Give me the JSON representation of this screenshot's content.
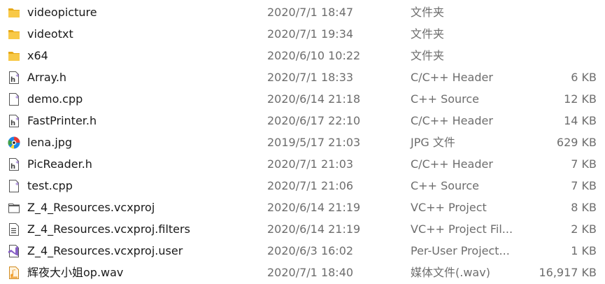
{
  "files": [
    {
      "icon": "folder-icon",
      "name": "videopicture",
      "date": "2020/7/1 18:47",
      "type": "文件夹",
      "size": ""
    },
    {
      "icon": "folder-icon",
      "name": "videotxt",
      "date": "2020/7/1 19:34",
      "type": "文件夹",
      "size": ""
    },
    {
      "icon": "folder-icon",
      "name": "x64",
      "date": "2020/6/10 10:22",
      "type": "文件夹",
      "size": ""
    },
    {
      "icon": "header-file-icon",
      "name": "Array.h",
      "date": "2020/7/1 18:33",
      "type": "C/C++ Header",
      "size": "6 KB"
    },
    {
      "icon": "cpp-source-icon",
      "name": "demo.cpp",
      "date": "2020/6/14 21:18",
      "type": "C++ Source",
      "size": "12 KB"
    },
    {
      "icon": "header-file-icon",
      "name": "FastPrinter.h",
      "date": "2020/6/17 22:10",
      "type": "C/C++ Header",
      "size": "14 KB"
    },
    {
      "icon": "image-viewer-icon",
      "name": "lena.jpg",
      "date": "2019/5/17 21:03",
      "type": "JPG 文件",
      "size": "629 KB"
    },
    {
      "icon": "header-file-icon",
      "name": "PicReader.h",
      "date": "2020/7/1 21:03",
      "type": "C/C++ Header",
      "size": "7 KB"
    },
    {
      "icon": "cpp-source-icon",
      "name": "test.cpp",
      "date": "2020/7/1 21:06",
      "type": "C++ Source",
      "size": "7 KB"
    },
    {
      "icon": "vcxproj-icon",
      "name": "Z_4_Resources.vcxproj",
      "date": "2020/6/14 21:19",
      "type": "VC++ Project",
      "size": "8 KB"
    },
    {
      "icon": "filters-file-icon",
      "name": "Z_4_Resources.vcxproj.filters",
      "date": "2020/6/14 21:19",
      "type": "VC++ Project Fil...",
      "size": "2 KB"
    },
    {
      "icon": "visual-studio-icon",
      "name": "Z_4_Resources.vcxproj.user",
      "date": "2020/6/3 16:02",
      "type": "Per-User Project...",
      "size": "1 KB"
    },
    {
      "icon": "audio-file-icon",
      "name": "辉夜大小姐op.wav",
      "date": "2020/7/1 18:40",
      "type": "媒体文件(.wav)",
      "size": "16,917 KB"
    }
  ],
  "colors": {
    "folder": "#f8c948",
    "folder_dark": "#e6a817",
    "name_text": "#1a1a1a",
    "detail_text": "#6d6d6d",
    "vs_purple": "#865fc5",
    "audio_orange": "#f0a030"
  }
}
